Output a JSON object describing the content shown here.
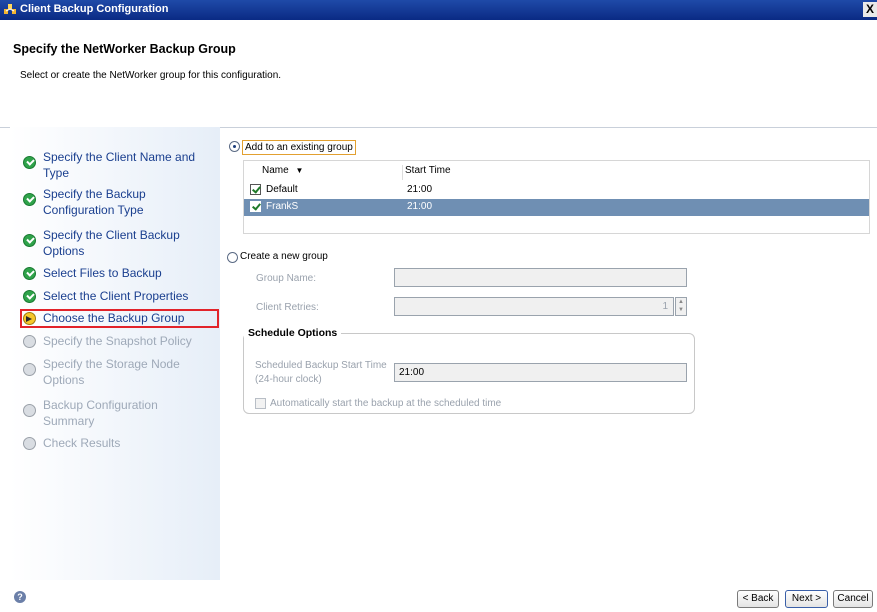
{
  "window": {
    "title": "Client Backup Configuration",
    "close_glyph": "X"
  },
  "header": {
    "title": "Specify the NetWorker Backup Group",
    "subtitle": "Select or create the NetWorker group for this configuration."
  },
  "sidebar": {
    "items": [
      {
        "label": "Specify the Client Name and Type",
        "state": "done"
      },
      {
        "label": "Specify the Backup Configuration Type",
        "state": "done"
      },
      {
        "label": "Specify the Client Backup Options",
        "state": "done"
      },
      {
        "label": "Select Files to Backup",
        "state": "done"
      },
      {
        "label": "Select the Client Properties",
        "state": "done"
      },
      {
        "label": "Choose the Backup Group",
        "state": "current"
      },
      {
        "label": "Specify the Snapshot Policy",
        "state": "pending"
      },
      {
        "label": "Specify the Storage Node Options",
        "state": "pending"
      },
      {
        "label": "Backup Configuration Summary",
        "state": "pending"
      },
      {
        "label": "Check Results",
        "state": "pending"
      }
    ]
  },
  "existing": {
    "radio_label": "Add to an existing group",
    "columns": {
      "name": "Name",
      "start_time": "Start Time"
    },
    "rows": [
      {
        "name": "Default",
        "start_time": "21:00",
        "checked": true,
        "selected": false
      },
      {
        "name": "FrankS",
        "start_time": "21:00",
        "checked": true,
        "selected": true
      }
    ]
  },
  "new_group": {
    "radio_label": "Create a new group",
    "group_name_label": "Group Name:",
    "group_name_value": "",
    "client_retries_label": "Client Retries:",
    "client_retries_value": "1",
    "schedule": {
      "legend": "Schedule Options",
      "start_time_label_1": "Scheduled Backup Start Time",
      "start_time_label_2": "(24-hour clock)",
      "start_time_value": "21:00",
      "auto_start_label": "Automatically start the backup at the scheduled time"
    }
  },
  "footer": {
    "back": "< Back",
    "next": "Next >",
    "cancel": "Cancel",
    "help_glyph": "?"
  },
  "colors": {
    "accent_blue": "#1a3f8f",
    "selection": "#6f8fb3",
    "highlight_box": "#e2232a"
  }
}
